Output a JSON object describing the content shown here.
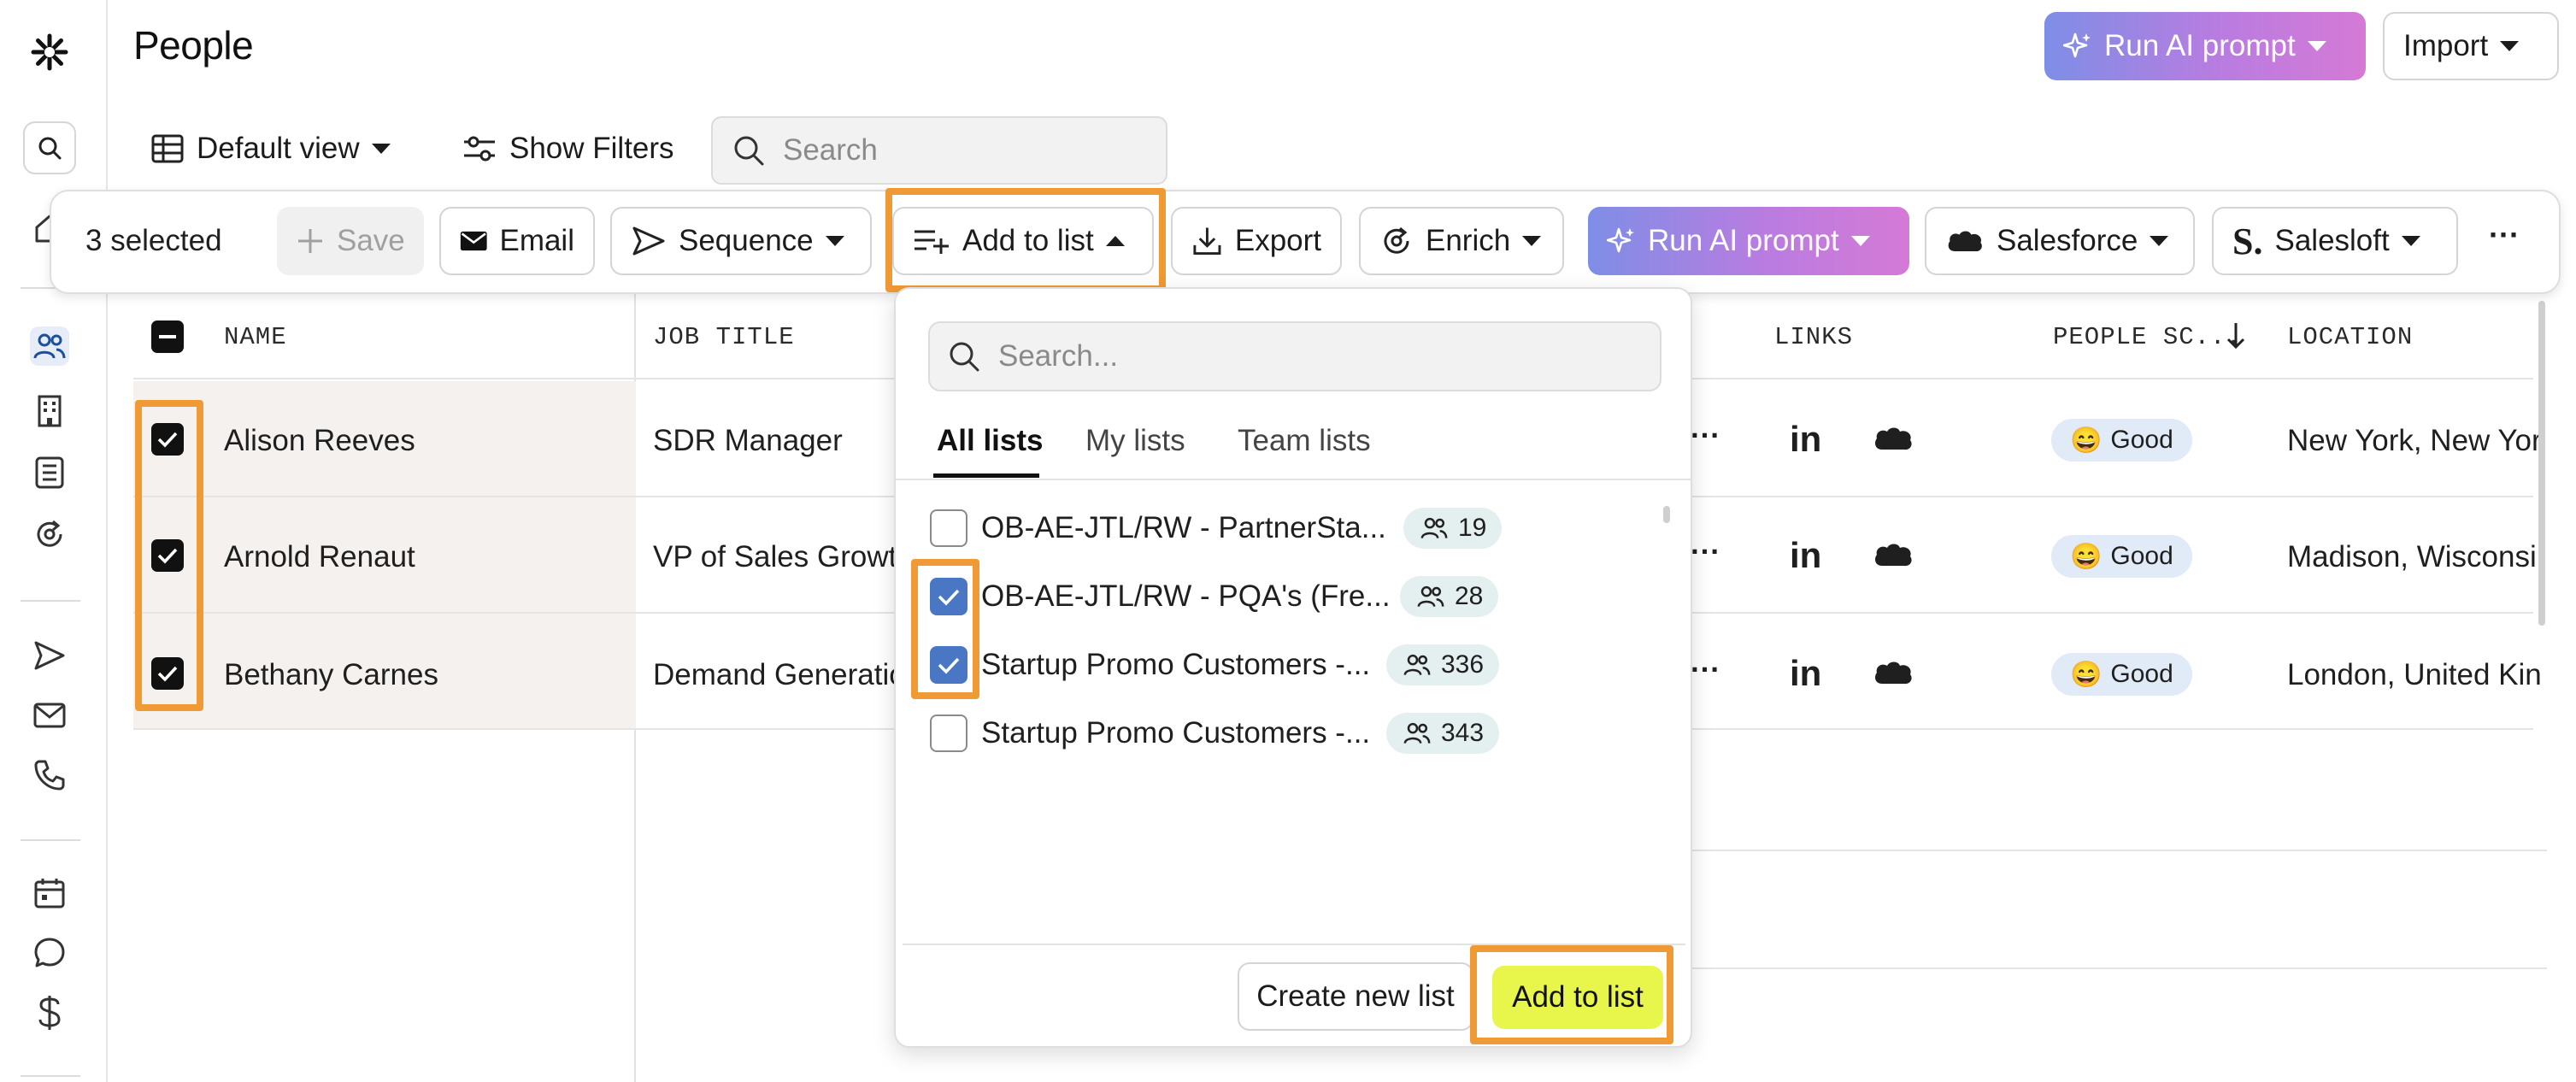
{
  "page": {
    "title": "People"
  },
  "header": {
    "run_ai_label": "Run AI prompt",
    "import_label": "Import"
  },
  "toolbar": {
    "view_label": "Default view",
    "filters_label": "Show Filters",
    "search_placeholder": "Search"
  },
  "action_bar": {
    "selected_text": "3 selected",
    "save": "Save",
    "email": "Email",
    "sequence": "Sequence",
    "add_to_list": "Add to list",
    "export": "Export",
    "enrich": "Enrich",
    "run_ai": "Run AI prompt",
    "salesforce": "Salesforce",
    "salesloft": "Salesloft",
    "more": "···"
  },
  "table": {
    "columns": {
      "name": "NAME",
      "job_title": "JOB TITLE",
      "links": "LINKS",
      "people_score": "PEOPLE SC...",
      "location": "LOCATION"
    },
    "rows": [
      {
        "name": "Alison Reeves",
        "title": "SDR Manager",
        "score": "Good",
        "location": "New York, New Yor"
      },
      {
        "name": "Arnold Renaut",
        "title": "VP of Sales Growt",
        "score": "Good",
        "location": "Madison, Wisconsi"
      },
      {
        "name": "Bethany Carnes",
        "title": "Demand Generatio",
        "score": "Good",
        "location": "London, United Kin"
      }
    ],
    "dots": "···"
  },
  "dropdown": {
    "search_placeholder": "Search...",
    "tabs": [
      "All lists",
      "My lists",
      "Team lists"
    ],
    "items": [
      {
        "label": "OB-AE-JTL/RW - PartnerSta...",
        "count": "19",
        "checked": false
      },
      {
        "label": "OB-AE-JTL/RW - PQA's (Fre...",
        "count": "28",
        "checked": true
      },
      {
        "label": "Startup Promo Customers -...",
        "count": "336",
        "checked": true
      },
      {
        "label": "Startup Promo Customers -...",
        "count": "343",
        "checked": false
      }
    ],
    "create_label": "Create new list",
    "add_label": "Add to list"
  },
  "colors": {
    "highlight": "#ef9a34",
    "add_button": "#e8f54a",
    "checked_blue": "#4a77c4",
    "score_badge": "#e1eaf7"
  }
}
